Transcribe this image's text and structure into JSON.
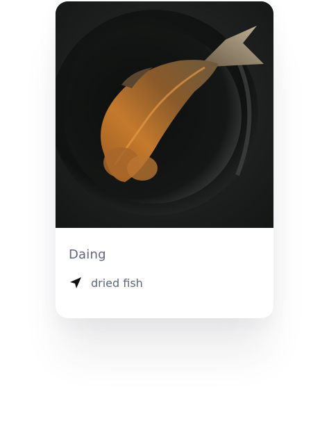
{
  "card": {
    "title": "Daing",
    "category_icon": "navigation-arrow-icon",
    "category": "dried fish",
    "image_subject": "dried fish on a dark plate"
  },
  "colors": {
    "text": "#5e6480",
    "icon": "#111111",
    "photo_background": "#1b1d1c"
  }
}
